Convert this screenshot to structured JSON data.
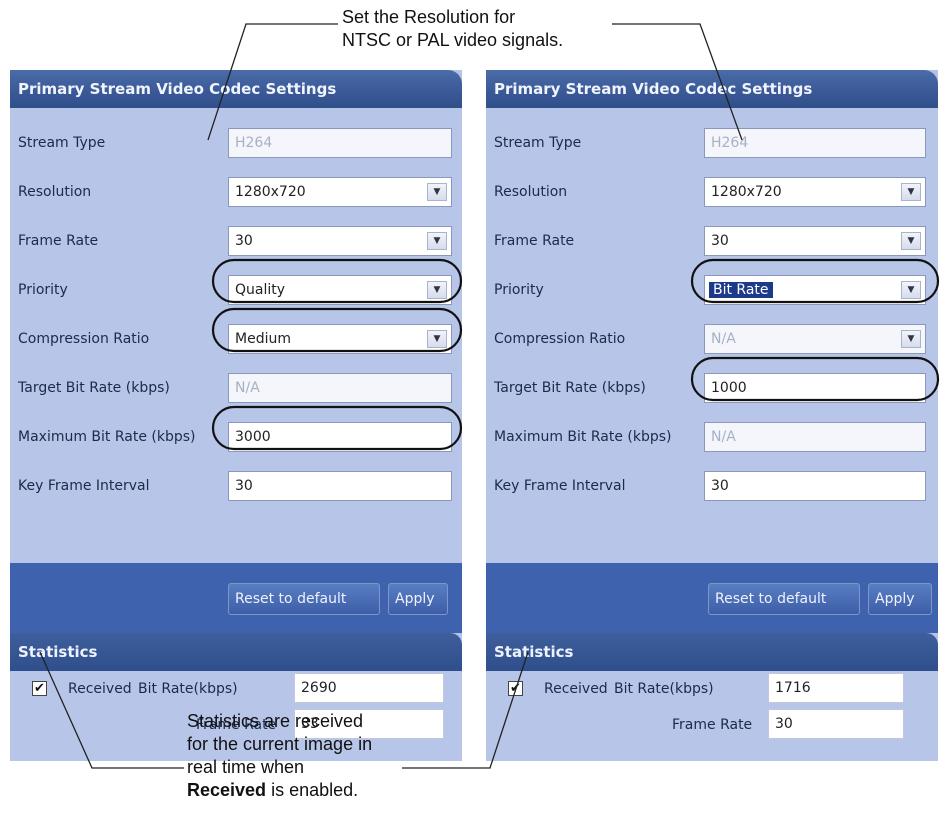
{
  "callouts": {
    "top_line1": "Set the Resolution for",
    "top_line2": "NTSC or PAL video signals.",
    "bottom_line1": "Statistics are received",
    "bottom_line2": "for the current image in",
    "bottom_line3": "real time when",
    "bottom_bold": "Received",
    "bottom_tail": " is enabled."
  },
  "left": {
    "title": "Primary Stream Video Codec Settings",
    "labels": {
      "stream_type": "Stream Type",
      "resolution": "Resolution",
      "frame_rate": "Frame Rate",
      "priority": "Priority",
      "compression": "Compression Ratio",
      "target": "Target Bit Rate (kbps)",
      "maximum": "Maximum Bit Rate (kbps)",
      "keyframe": "Key Frame Interval"
    },
    "values": {
      "stream_type": "H264",
      "resolution": "1280x720",
      "frame_rate": "30",
      "priority": "Quality",
      "compression": "Medium",
      "target": "N/A",
      "maximum": "3000",
      "keyframe": "30"
    },
    "buttons": {
      "reset": "Reset to default",
      "apply": "Apply"
    },
    "stats": {
      "title": "Statistics",
      "check": "🗹",
      "received": "Received",
      "bitrate_label": "Bit Rate(kbps)",
      "bitrate_value": "2690",
      "framerate_label": "Frame Rate",
      "framerate_value": "33"
    }
  },
  "right": {
    "title": "Primary Stream Video Codec Settings",
    "labels": {
      "stream_type": "Stream Type",
      "resolution": "Resolution",
      "frame_rate": "Frame Rate",
      "priority": "Priority",
      "compression": "Compression Ratio",
      "target": "Target Bit Rate (kbps)",
      "maximum": "Maximum Bit Rate (kbps)",
      "keyframe": "Key Frame Interval"
    },
    "values": {
      "stream_type": "H264",
      "resolution": "1280x720",
      "frame_rate": "30",
      "priority": "Bit Rate",
      "compression": "N/A",
      "target": "1000",
      "maximum": "N/A",
      "keyframe": "30"
    },
    "buttons": {
      "reset": "Reset to default",
      "apply": "Apply"
    },
    "stats": {
      "title": "Statistics",
      "check": "🗹",
      "received": "Received",
      "bitrate_label": "Bit Rate(kbps)",
      "bitrate_value": "1716",
      "framerate_label": "Frame Rate",
      "framerate_value": "30"
    }
  },
  "icons": {
    "dropdown_arrow": "▼",
    "check_mark": "✔"
  }
}
